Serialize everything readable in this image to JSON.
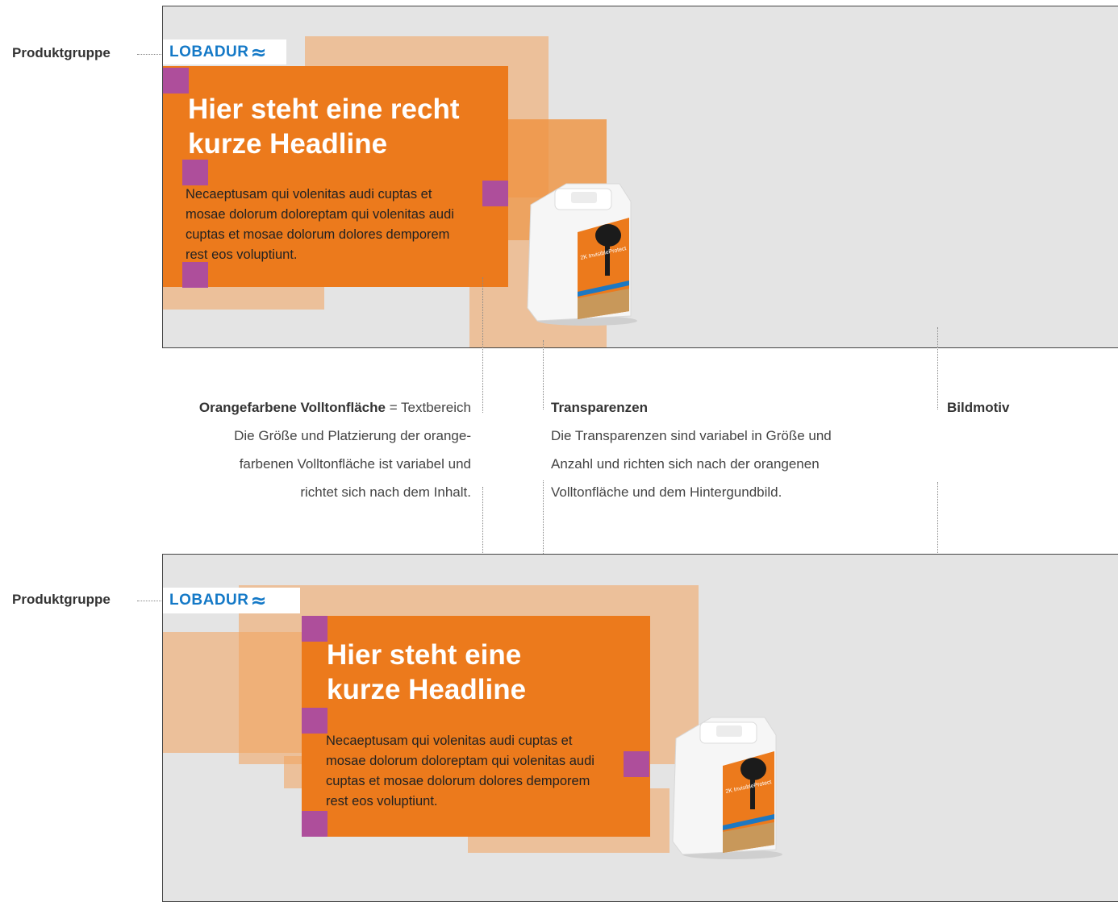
{
  "labels": {
    "produktgruppe_top": "Produktgruppe",
    "produktgruppe_bottom": "Produktgruppe"
  },
  "banner_top": {
    "logo": "LOBADUR",
    "logo_mark": "≈",
    "headline": "Hier steht eine recht\nkurze Headline",
    "body": "Necaeptusam qui volenitas audi cuptas et\nmosae dolorum doloreptam qui volenitas audi\ncuptas et mosae dolorum dolores demporem\nrest eos voluptiunt."
  },
  "banner_bottom": {
    "logo": "LOBADUR",
    "logo_mark": "≈",
    "headline": "Hier steht eine\nkurze Headline",
    "body": "Necaeptusam qui volenitas audi cuptas et\nmosae dolorum doloreptam qui volenitas audi\ncuptas et mosae dolorum dolores demporem\nrest eos voluptiunt."
  },
  "annotations": {
    "orange": {
      "title": "Orangefarbene Volltonfläche",
      "title_suffix": " = Textbereich",
      "line1": "Die Größe und Platzierung der orange-",
      "line2": "farbenen Volltonfläche ist variabel und",
      "line3": "richtet sich nach dem Inhalt."
    },
    "transparenzen": {
      "title": "Transparenzen",
      "line1": "Die Transparenzen sind variabel in Größe und",
      "line2": "Anzahl und richten sich nach der orangenen",
      "line3": "Volltonfläche und dem Hintergundbild."
    },
    "bildmotiv": {
      "title": "Bildmotiv"
    }
  },
  "colors": {
    "orange": "#ec7a1c",
    "transparency": "#f3a35c",
    "purple": "#a84aa6",
    "logo_blue": "#1479c7",
    "background": "#e4e4e4"
  },
  "product_label": "2K InvisibleProtect"
}
